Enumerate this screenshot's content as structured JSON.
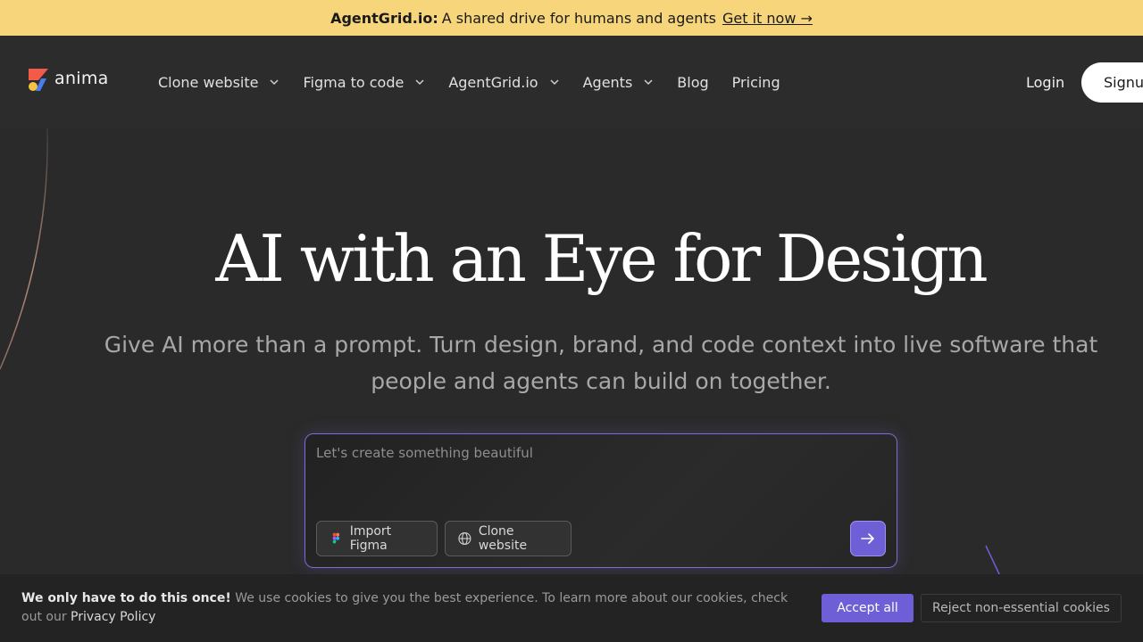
{
  "banner": {
    "brand": "AgentGrid.io:",
    "text": "A shared drive for humans and agents",
    "link": "Get it now →"
  },
  "nav": {
    "logo_text": "anima",
    "items": [
      {
        "label": "Clone website",
        "dropdown": true
      },
      {
        "label": "Figma to code",
        "dropdown": true
      },
      {
        "label": "AgentGrid.io",
        "dropdown": true
      },
      {
        "label": "Agents",
        "dropdown": true
      },
      {
        "label": "Blog",
        "dropdown": false
      },
      {
        "label": "Pricing",
        "dropdown": false
      }
    ],
    "login": "Login",
    "signup": "Signu"
  },
  "hero": {
    "title": "AI with an Eye for Design",
    "subtitle": "Give AI more than a prompt. Turn design, brand, and code context into live software that people and agents can build on together."
  },
  "prompt": {
    "placeholder": "Let's create something beautiful",
    "import_figma": "Import Figma",
    "clone_website": "Clone website"
  },
  "cookie": {
    "bold": "We only have to do this once!",
    "text": "We use cookies to give you the best experience. To learn more about our cookies, check out our",
    "policy_link": "Privacy Policy",
    "accept": "Accept all",
    "reject": "Reject non-essential cookies"
  },
  "colors": {
    "banner_bg": "#f7d57a",
    "page_bg": "#2a2a2a",
    "accent": "#6e5fd6"
  }
}
